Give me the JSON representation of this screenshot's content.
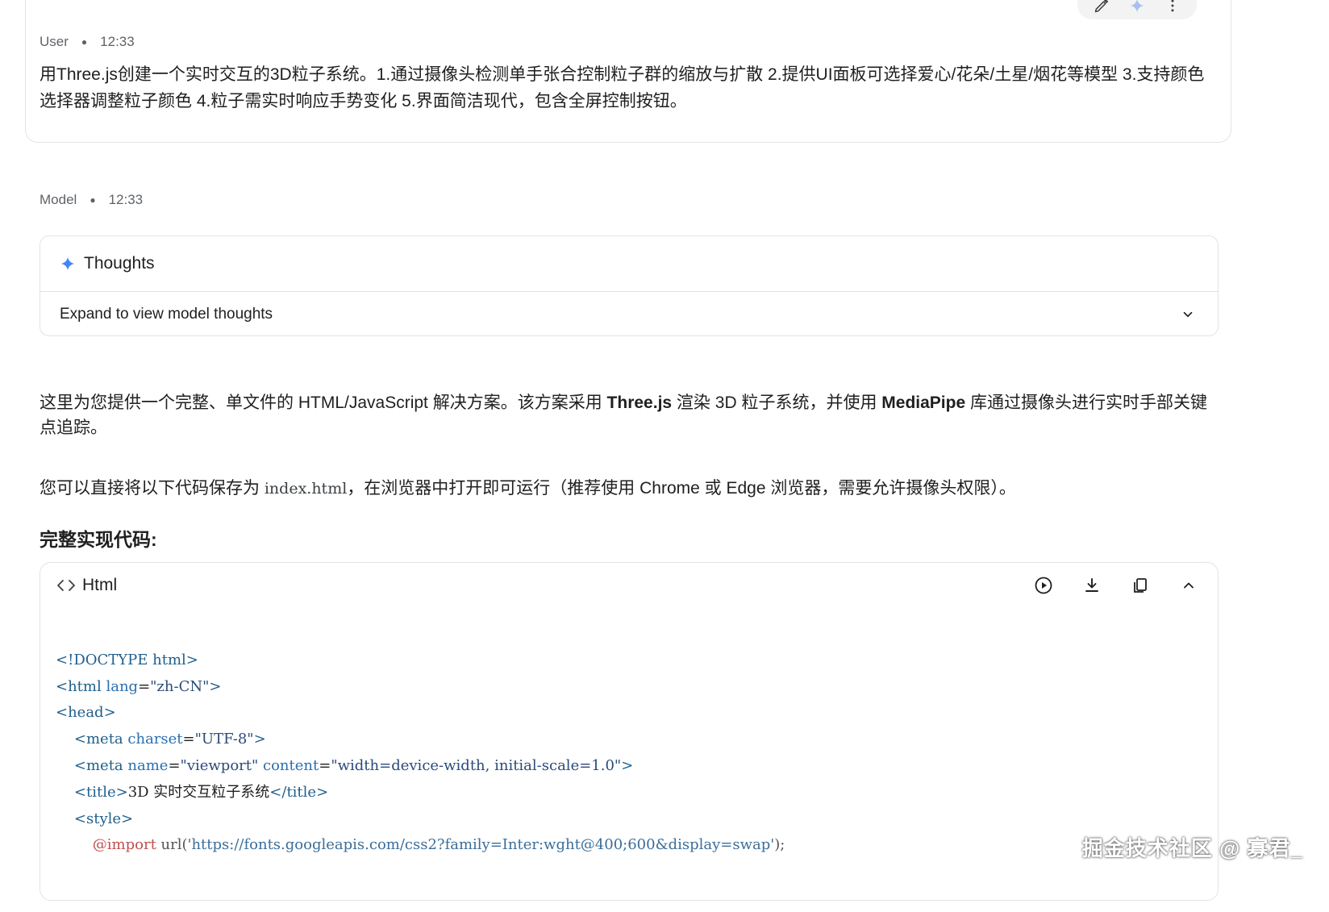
{
  "user_message": {
    "author": "User",
    "time": "12:33",
    "text": "用Three.js创建一个实时交互的3D粒子系统。1.通过摄像头检测单手张合控制粒子群的缩放与扩散 2.提供UI面板可选择爱心/花朵/土星/烟花等模型 3.支持颜色选择器调整粒子颜色 4.粒子需实时响应手势变化 5.界面简洁现代，包含全屏控制按钮。",
    "toolbar_icons": [
      "edit-icon",
      "sparkle-icon",
      "more-vert-icon"
    ]
  },
  "model_message": {
    "author": "Model",
    "time": "12:33",
    "thoughts": {
      "title": "Thoughts",
      "expand_label": "Expand to view model thoughts"
    },
    "para1": {
      "t1": "这里为您提供一个完整、单文件的 HTML/JavaScript 解决方案。该方案采用 ",
      "b1": "Three.js",
      "t2": " 渲染 3D 粒子系统，并使用 ",
      "b2": "MediaPipe",
      "t3": " 库通过摄像头进行实时手部关键点追踪。"
    },
    "para2": {
      "t1": "您可以直接将以下代码保存为 ",
      "code": "index.html",
      "t2": "，在浏览器中打开即可运行（推荐使用 Chrome 或 Edge 浏览器，需要允许摄像头权限）。"
    },
    "section_title": "完整实现代码:",
    "code_block": {
      "language": "Html",
      "lines": [
        {
          "l1": "<!DOCTYPE html>"
        },
        {
          "a": "<html",
          "b": " lang",
          "c": "=",
          "d": "\"zh-CN\"",
          "e": ">"
        },
        {
          "a": "<head>"
        },
        {
          "indent": "    ",
          "a": "<meta",
          "b": " charset",
          "c": "=",
          "d": "\"UTF-8\"",
          "e": ">"
        },
        {
          "indent": "    ",
          "a": "<meta",
          "b": " name",
          "c": "=",
          "d": "\"viewport\"",
          "b2": " content",
          "c2": "=",
          "d2": "\"width=device-width, initial-scale=1.0\"",
          "e": ">"
        },
        {
          "indent": "    ",
          "a": "<title>",
          "t": "3D 实时交互粒子系统",
          "e": "</title>"
        },
        {
          "indent": "    ",
          "a": "<style>"
        },
        {
          "indent": "        ",
          "kw": "@import",
          "fn": " url(",
          "url": "'https://fonts.googleapis.com/css2?family=Inter:wght@400;600&display=swap'",
          "end": ");"
        }
      ]
    }
  },
  "watermark": "掘金技术社区 @ 寡君_",
  "colors": {
    "accent_sparkle": "#4285f4",
    "border": "#e3e3e3",
    "code_tag": "#1f5f8b",
    "code_keyword": "#c0504d"
  }
}
